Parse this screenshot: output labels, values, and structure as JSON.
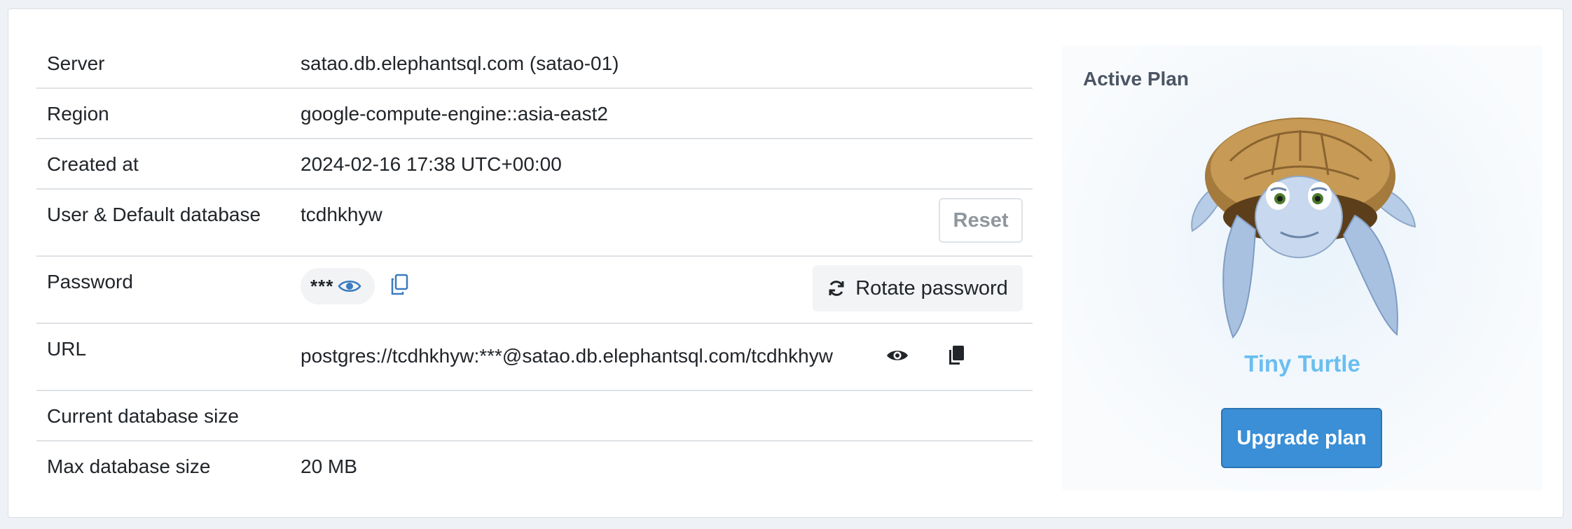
{
  "details": {
    "server": {
      "label": "Server",
      "value": "satao.db.elephantsql.com (satao-01)"
    },
    "region": {
      "label": "Region",
      "value": "google-compute-engine::asia-east2"
    },
    "created": {
      "label": "Created at",
      "value": "2024-02-16 17:38 UTC+00:00"
    },
    "user": {
      "label": "User & Default database",
      "value": "tcdhkhyw",
      "reset_label": "Reset"
    },
    "password": {
      "label": "Password",
      "masked": "***",
      "rotate_label": "Rotate password"
    },
    "url": {
      "label": "URL",
      "value": "postgres://tcdhkhyw:***@satao.db.elephantsql.com/tcdhkhyw"
    },
    "current_size": {
      "label": "Current database size",
      "value": ""
    },
    "max_size": {
      "label": "Max database size",
      "value": "20 MB"
    }
  },
  "plan": {
    "title": "Active Plan",
    "name": "Tiny Turtle",
    "upgrade_label": "Upgrade plan",
    "mascot": "turtle-mascot"
  },
  "icons": {
    "eye": "eye-icon",
    "copy": "copy-icon",
    "rotate": "refresh-icon"
  },
  "colors": {
    "accent_blue": "#3a8fd6",
    "plan_name": "#6bbef0",
    "icon_blue": "#3b7bbf"
  }
}
